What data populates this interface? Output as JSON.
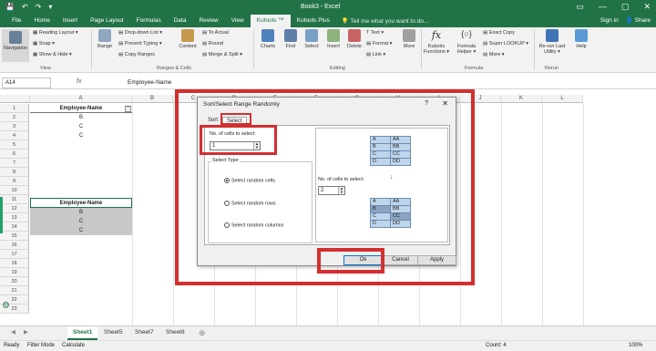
{
  "app": {
    "title": "Book3 - Excel",
    "quick_access": [
      "💾",
      "↶",
      "↷",
      "▾"
    ],
    "win_controls": [
      "▭",
      "—",
      "▢",
      "✕"
    ]
  },
  "tabs": [
    "File",
    "Home",
    "Insert",
    "Page Layout",
    "Formulas",
    "Data",
    "Review",
    "View",
    "Kutools ™",
    "Kutools Plus"
  ],
  "tell_me": "Tell me what you want to do...",
  "sign_in": "Sign in",
  "share": "Share",
  "ribbon": {
    "navigation": "Navigation",
    "view_items": [
      "Reading Layout ▾",
      "Snap ▾",
      "Show & Hide ▾"
    ],
    "range": "Range",
    "range_items": [
      "Drop-down List ▾",
      "Prevent Typing ▾",
      "Copy Ranges"
    ],
    "content": "Content",
    "content_items": [
      "To Actual",
      "Round",
      "Merge & Split ▾"
    ],
    "charts": "Charts",
    "find": "Find",
    "select": "Select",
    "insert": "Insert",
    "delete": "Delete",
    "text_items": [
      "Text ▾",
      "Format ▾",
      "Link ▾"
    ],
    "more": "More",
    "kutools_functions": "Kutools Functions ▾",
    "formula_helper": "Formula Helper ▾",
    "formula_items": [
      "Exact Copy",
      "Super LOOKUP ▾",
      "More ▾"
    ],
    "rerun": "Re-run Last Utility ▾",
    "help": "Help",
    "groups": [
      "View",
      "Ranges & Cells",
      "Editing",
      "Formula",
      "Rerun"
    ]
  },
  "formula_bar": {
    "name_box": "A14",
    "fx": "fx",
    "value": "Employee-Name"
  },
  "columns": [
    "A",
    "B",
    "C",
    "D",
    "E",
    "F",
    "G",
    "H",
    "I",
    "J",
    "K",
    "L"
  ],
  "rows": [
    "1",
    "2",
    "3",
    "4",
    "5",
    "6",
    "7",
    "8",
    "9",
    "10",
    "11",
    "12",
    "13",
    "14",
    "15",
    "16",
    "17",
    "18",
    "19",
    "20",
    "21",
    "22",
    "23"
  ],
  "cells": {
    "a1": "Employee-Name",
    "a2": "B",
    "a3": "C",
    "a4": "C",
    "a14": "Employee-Name",
    "a15": "B",
    "a16": "C",
    "a17": "C"
  },
  "sheet_tabs": [
    "Sheet1",
    "Sheet5",
    "Sheet7",
    "Sheet8"
  ],
  "status": {
    "ready": "Ready",
    "filter_mode": "Filter Mode",
    "calculate": "Calculate",
    "count": "Count: 4",
    "zoom": "100%"
  },
  "dialog": {
    "title": "Sort/Select Range Randomly",
    "help": "?",
    "close": "✕",
    "tabs": [
      "Sort",
      "Select"
    ],
    "num_cells_label": "No. of cells to select:",
    "num_cells_value": "1",
    "select_type_label": "Select Type",
    "options": [
      "Select random cells",
      "Select random rows",
      "Select random columns"
    ],
    "preview_label": "No. of cells to select:",
    "preview_value": "2",
    "preview_top": [
      [
        "A",
        "AA"
      ],
      [
        "B",
        "BB"
      ],
      [
        "C",
        "CC"
      ],
      [
        "D",
        "DD"
      ]
    ],
    "preview_bottom": [
      [
        "A",
        "AA"
      ],
      [
        "B",
        "BB"
      ],
      [
        "C",
        "CC"
      ],
      [
        "D",
        "DD"
      ]
    ],
    "ok": "Ok",
    "cancel": "Cancel",
    "apply": "Apply"
  }
}
